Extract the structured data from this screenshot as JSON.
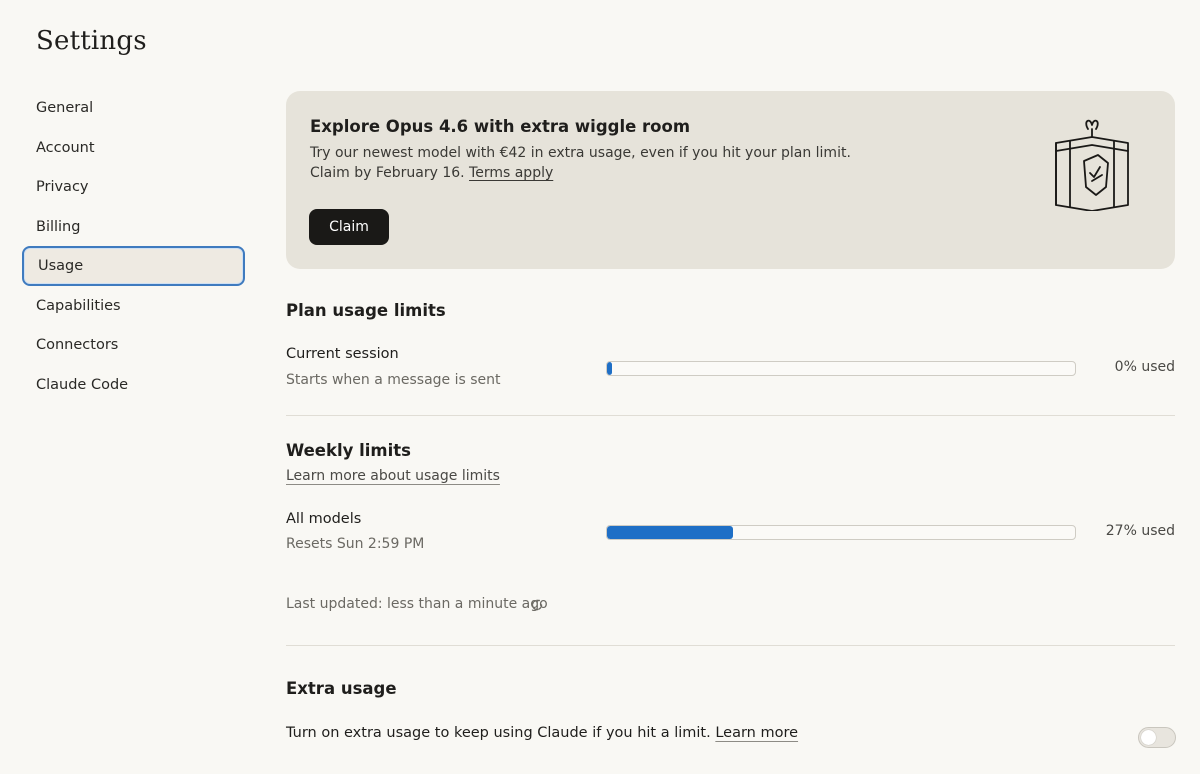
{
  "page": {
    "title": "Settings"
  },
  "sidebar": {
    "items": [
      {
        "label": "General"
      },
      {
        "label": "Account"
      },
      {
        "label": "Privacy"
      },
      {
        "label": "Billing"
      },
      {
        "label": "Usage"
      },
      {
        "label": "Capabilities"
      },
      {
        "label": "Connectors"
      },
      {
        "label": "Claude Code"
      }
    ],
    "active": "Usage"
  },
  "promo": {
    "title": "Explore Opus 4.6 with extra wiggle room",
    "line1": "Try our newest model with €42 in extra usage, even if you hit your plan limit.",
    "line2": "Claim by February 16. ",
    "terms_link": "Terms apply",
    "claim_label": "Claim",
    "icon": "gift-tag-icon"
  },
  "plan_usage": {
    "heading": "Plan usage limits",
    "current_session": {
      "label": "Current session",
      "sub": "Starts when a message is sent",
      "percent": 0,
      "used_text": "0% used"
    }
  },
  "weekly": {
    "heading": "Weekly limits",
    "learn_link": "Learn more about usage limits",
    "all_models": {
      "label": "All models",
      "sub": "Resets Sun 2:59 PM",
      "percent": 27,
      "used_text": "27% used"
    },
    "last_updated": "Last updated: less than a minute ago"
  },
  "extra_usage": {
    "heading": "Extra usage",
    "text": "Turn on extra usage to keep using Claude if you hit a limit. ",
    "learn_link": "Learn more",
    "toggle_on": false
  },
  "colors": {
    "accent": "#1f6fc6",
    "promo_bg": "#e6e3da",
    "page_bg": "#f9f8f4"
  }
}
